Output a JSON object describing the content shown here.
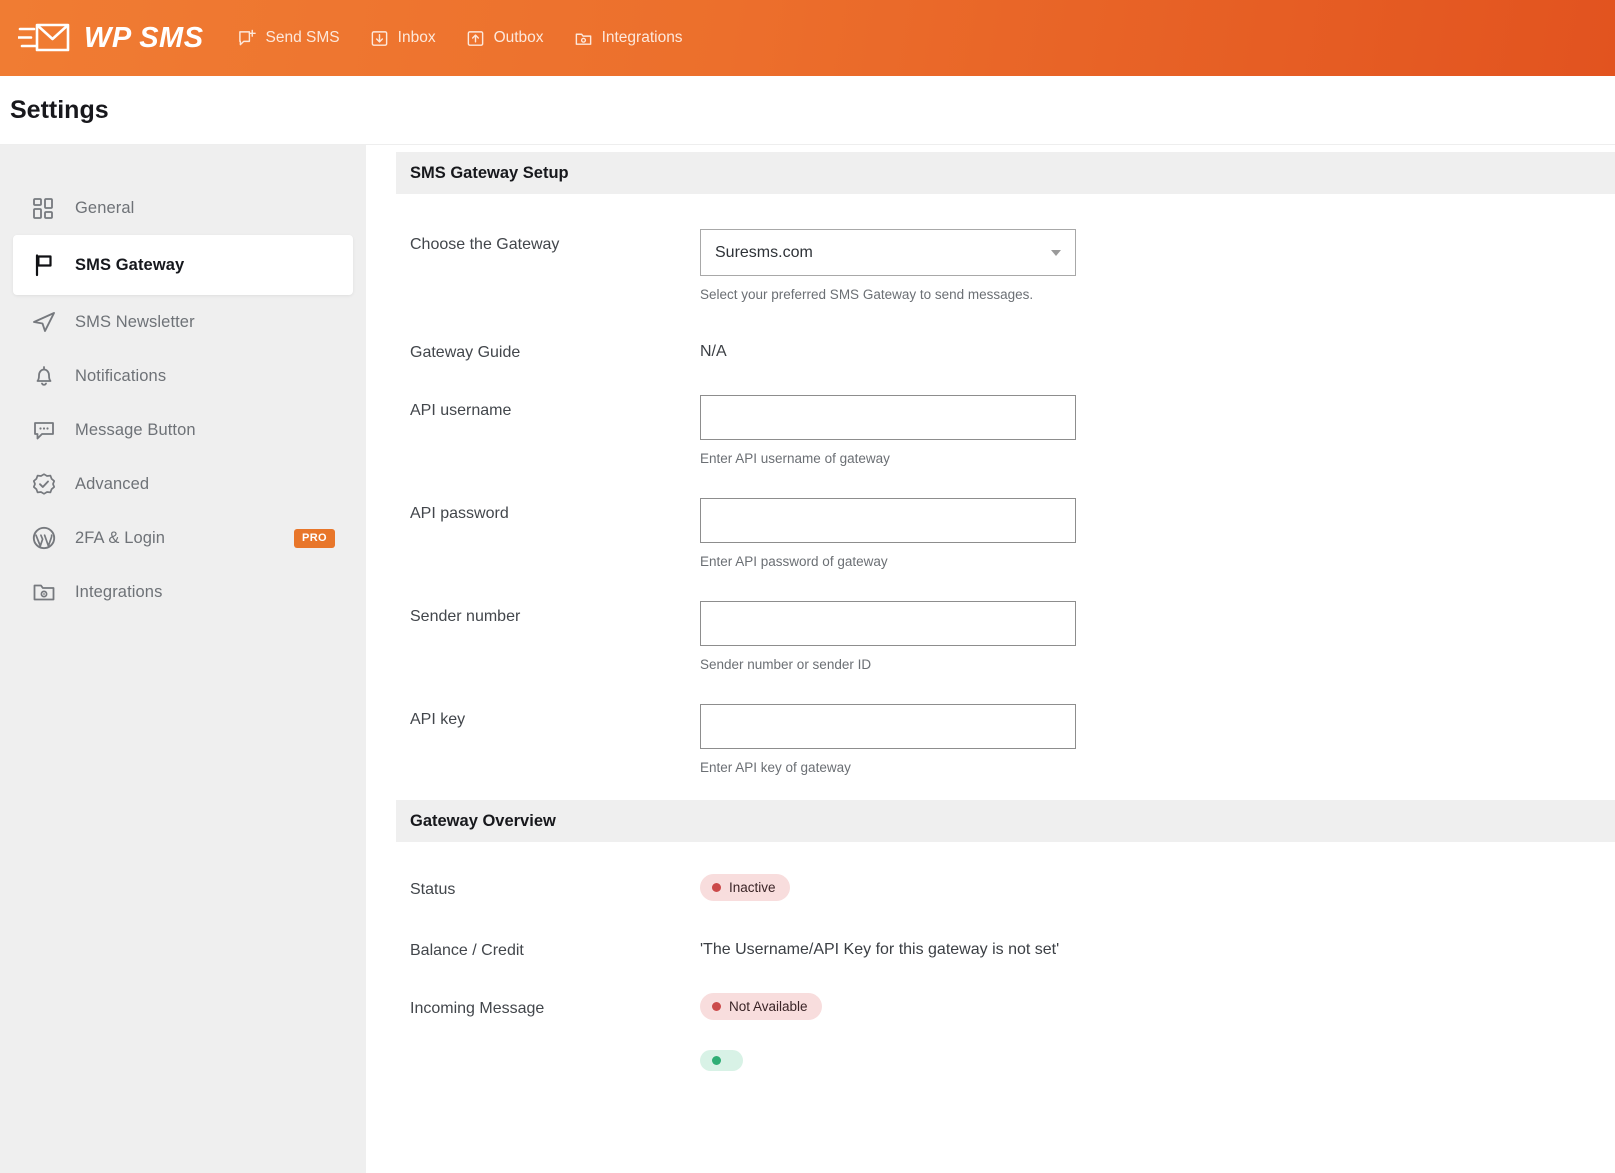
{
  "topbar": {
    "brand_name": "WP SMS",
    "brand_icon": "envelope-send-icon",
    "nav": [
      {
        "label": "Send SMS",
        "icon": "compose-message-icon"
      },
      {
        "label": "Inbox",
        "icon": "inbox-download-icon"
      },
      {
        "label": "Outbox",
        "icon": "outbox-upload-icon"
      },
      {
        "label": "Integrations",
        "icon": "folder-gear-icon"
      }
    ]
  },
  "page": {
    "title": "Settings"
  },
  "sidebar": {
    "items": [
      {
        "label": "General",
        "icon": "grid-squares-icon",
        "active": false,
        "badge": ""
      },
      {
        "label": "SMS Gateway",
        "icon": "flag-icon",
        "active": true,
        "badge": ""
      },
      {
        "label": "SMS Newsletter",
        "icon": "paper-plane-icon",
        "active": false,
        "badge": ""
      },
      {
        "label": "Notifications",
        "icon": "bell-icon",
        "active": false,
        "badge": ""
      },
      {
        "label": "Message Button",
        "icon": "chat-bubble-icon",
        "active": false,
        "badge": ""
      },
      {
        "label": "Advanced",
        "icon": "badge-check-icon",
        "active": false,
        "badge": ""
      },
      {
        "label": "2FA & Login",
        "icon": "wordpress-icon",
        "active": false,
        "badge": "PRO"
      },
      {
        "label": "Integrations",
        "icon": "folder-gear-icon",
        "active": false,
        "badge": ""
      }
    ]
  },
  "main": {
    "setup_section": {
      "title": "SMS Gateway Setup",
      "gateway_row": {
        "label": "Choose the Gateway",
        "selected": "Suresms.com",
        "hint": "Select your preferred SMS Gateway to send messages.",
        "caret_icon": "chevron-down-icon"
      },
      "guide_row": {
        "label": "Gateway Guide",
        "value": "N/A"
      },
      "fields": [
        {
          "label": "API username",
          "value": "",
          "placeholder": "",
          "hint": "Enter API username of gateway"
        },
        {
          "label": "API password",
          "value": "",
          "placeholder": "",
          "hint": "Enter API password of gateway"
        },
        {
          "label": "Sender number",
          "value": "",
          "placeholder": "",
          "hint": "Sender number or sender ID"
        },
        {
          "label": "API key",
          "value": "",
          "placeholder": "",
          "hint": "Enter API key of gateway"
        }
      ]
    },
    "overview_section": {
      "title": "Gateway Overview",
      "status_row": {
        "label": "Status",
        "badge_text": "Inactive",
        "badge_tone": "red"
      },
      "balance_row": {
        "label": "Balance / Credit",
        "value": "'The Username/API Key for this gateway is not set'"
      },
      "incoming_row": {
        "label": "Incoming Message",
        "badge_text": "Not Available",
        "badge_tone": "red"
      },
      "partial_row": {
        "badge_text": "",
        "badge_tone": "green"
      }
    }
  },
  "colors": {
    "brand_orange": "#e8762a",
    "topbar_gradient_from": "#f07c33",
    "topbar_gradient_to": "#e2531f",
    "sidebar_bg": "#efefef",
    "section_head_bg": "#efefef",
    "status_red": "#cb4a4a",
    "status_green": "#2fae75"
  }
}
